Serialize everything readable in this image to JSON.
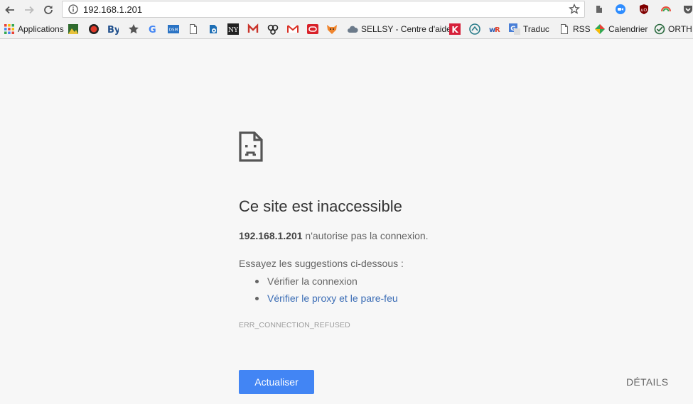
{
  "toolbar": {
    "back_icon": "arrow-left-icon",
    "forward_icon": "arrow-right-icon",
    "reload_icon": "reload-icon",
    "url": "192.168.1.201",
    "extensions": [
      "evernote-icon",
      "zoom-icon",
      "ublock-icon",
      "rainbow-icon",
      "pocket-icon"
    ]
  },
  "bookmarks": [
    {
      "label": "Applications",
      "icon": "apps-grid-icon"
    },
    {
      "label": "",
      "icon": "image-bookmark-icon"
    },
    {
      "label": "",
      "icon": "red-circle-icon"
    },
    {
      "label": "",
      "icon": "by-icon"
    },
    {
      "label": "",
      "icon": "star-bookmark-icon"
    },
    {
      "label": "",
      "icon": "google-icon"
    },
    {
      "label": "",
      "icon": "dsm-icon"
    },
    {
      "label": "",
      "icon": "page-icon"
    },
    {
      "label": "",
      "icon": "settings-page-icon"
    },
    {
      "label": "",
      "icon": "nyt-icon"
    },
    {
      "label": "",
      "icon": "m-icon"
    },
    {
      "label": "",
      "icon": "owl-icon"
    },
    {
      "label": "",
      "icon": "gmail-icon"
    },
    {
      "label": "",
      "icon": "red-box-icon"
    },
    {
      "label": "",
      "icon": "fox-icon"
    },
    {
      "label": "SELLSY - Centre d'aide",
      "icon": "cloud-icon"
    },
    {
      "label": "",
      "icon": "k-icon"
    },
    {
      "label": "",
      "icon": "circle-logo-icon"
    },
    {
      "label": "",
      "icon": "wr-icon"
    },
    {
      "label": "Traduc",
      "icon": "translate-icon"
    },
    {
      "label": "RSS",
      "icon": "page-icon"
    },
    {
      "label": "Calendrier",
      "icon": "calendar-diamond-icon"
    },
    {
      "label": "ORTH",
      "icon": "check-circle-icon"
    }
  ],
  "error": {
    "icon": "sad-page-icon",
    "title": "Ce site est inaccessible",
    "host": "192.168.1.201",
    "message": " n'autorise pas la connexion.",
    "suggest_intro": "Essayez les suggestions ci-dessous :",
    "suggestions": [
      "Vérifier la connexion",
      "Vérifier le proxy et le pare-feu"
    ],
    "code": "ERR_CONNECTION_REFUSED",
    "reload_label": "Actualiser",
    "details_label": "DÉTAILS"
  },
  "colors": {
    "accent": "#4285f4",
    "link": "#3a6cb5",
    "background": "#f7f7f7"
  }
}
